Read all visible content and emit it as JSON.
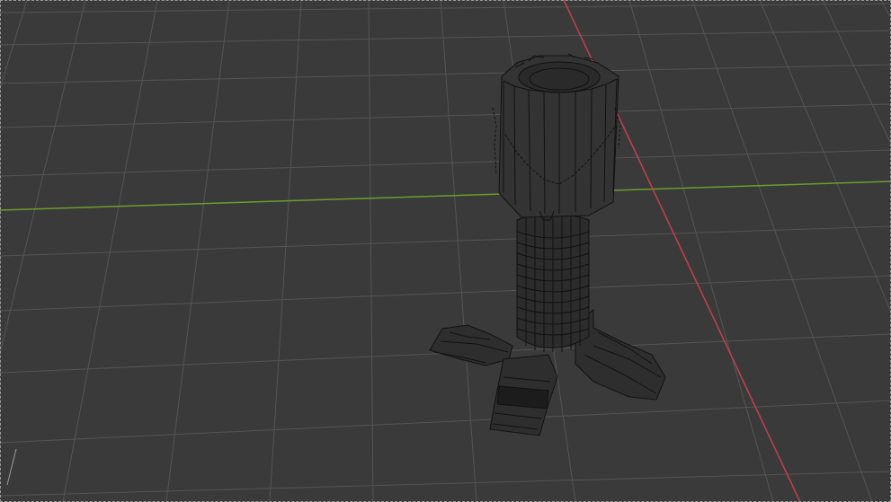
{
  "viewport": {
    "mode": "wireframe",
    "background_color": "#3a3a3a",
    "grid_color": "#555555",
    "x_axis_color": "#c0424e",
    "y_axis_color": "#6b9d2f",
    "wire_color": "#111111",
    "object": "tower-mesh"
  }
}
